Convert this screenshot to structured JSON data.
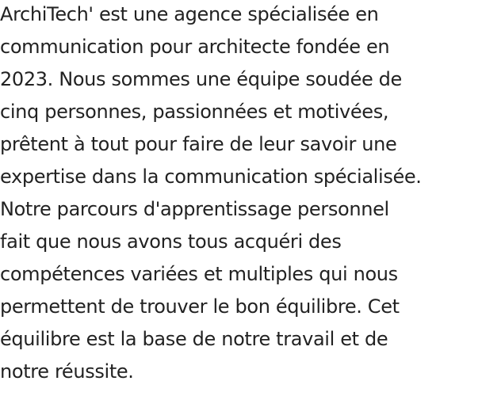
{
  "paragraph": {
    "lines": [
      "ArchiTech' est une agence spécialisée en",
      "communication pour architecte fondée en",
      "2023. Nous sommes une équipe soudée de",
      "cinq personnes, passionnées et motivées,",
      "prêtent à tout pour faire de leur savoir une",
      "expertise dans la communication spécialisée.",
      "Notre parcours d'apprentissage personnel",
      "fait que nous avons tous acquéri des",
      "compétences variées et multiples qui nous",
      "permettent de trouver le bon équilibre. Cet",
      "équilibre est la base de notre travail et de",
      "notre réussite."
    ]
  }
}
